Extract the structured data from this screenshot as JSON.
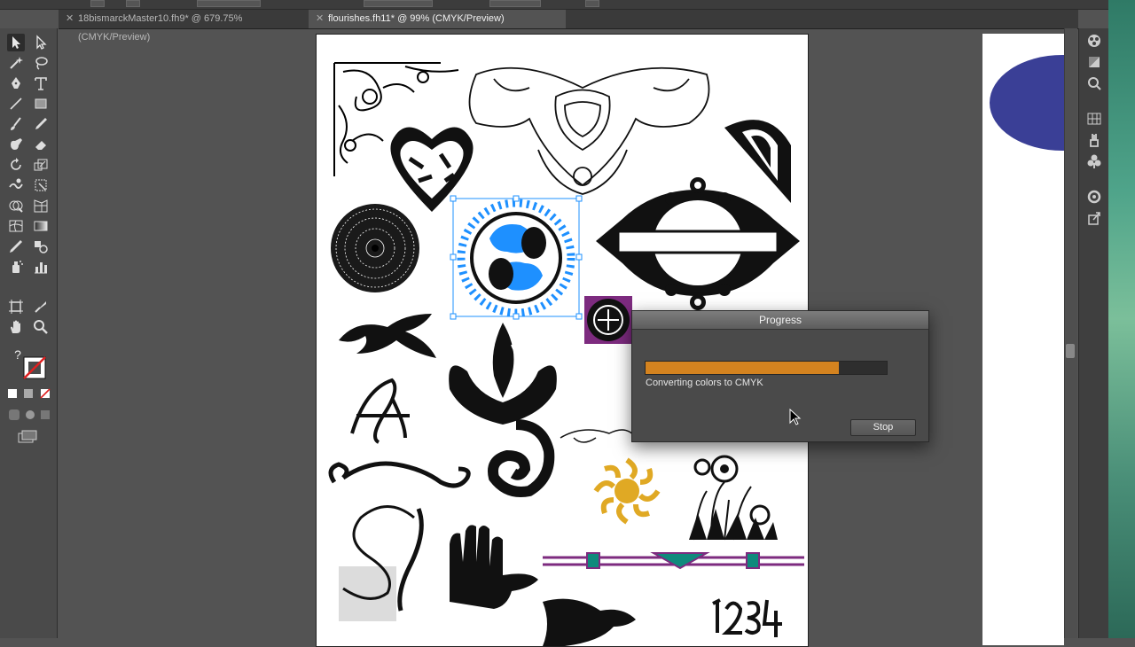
{
  "tabs": [
    {
      "label": "18bismarckMaster10.fh9* @ 679.75% (CMYK/Preview)",
      "active": false
    },
    {
      "label": "flourishes.fh11* @ 99% (CMYK/Preview)",
      "active": true
    }
  ],
  "tab_close_glyph": "✕",
  "toolbox": {
    "tools": [
      "selection-tool-icon",
      "direct-selection-tool-icon",
      "magic-wand-tool-icon",
      "lasso-tool-icon",
      "pen-tool-icon",
      "type-tool-icon",
      "line-tool-icon",
      "rectangle-tool-icon",
      "paintbrush-tool-icon",
      "pencil-tool-icon",
      "blob-brush-tool-icon",
      "eraser-tool-icon",
      "rotate-tool-icon",
      "scale-tool-icon",
      "warp-tool-icon",
      "free-transform-tool-icon",
      "shape-builder-tool-icon",
      "perspective-grid-tool-icon",
      "mesh-tool-icon",
      "gradient-tool-icon",
      "eyedropper-tool-icon",
      "blend-tool-icon",
      "symbol-sprayer-tool-icon",
      "column-graph-tool-icon",
      "artboard-tool-icon",
      "slice-tool-icon",
      "hand-tool-icon",
      "zoom-tool-icon"
    ],
    "unknown_glyph": "?"
  },
  "right_panel": {
    "icons": [
      "color-guide-icon",
      "color-icon",
      "appearance-icon",
      "swatches-icon",
      "brushes-icon",
      "symbols-icon",
      "stroke-icon",
      "export-icon"
    ]
  },
  "progress_dialog": {
    "title": "Progress",
    "status": "Converting colors to CMYK",
    "progress_fraction": 0.8,
    "stop_label": "Stop",
    "accent": "#d4831f"
  },
  "colors": {
    "selection": "#1e90ff",
    "ellipse": "#3a3f96",
    "gold": "#e0a924",
    "purple": "#7d2b7f",
    "teal": "#0f8a7c"
  }
}
